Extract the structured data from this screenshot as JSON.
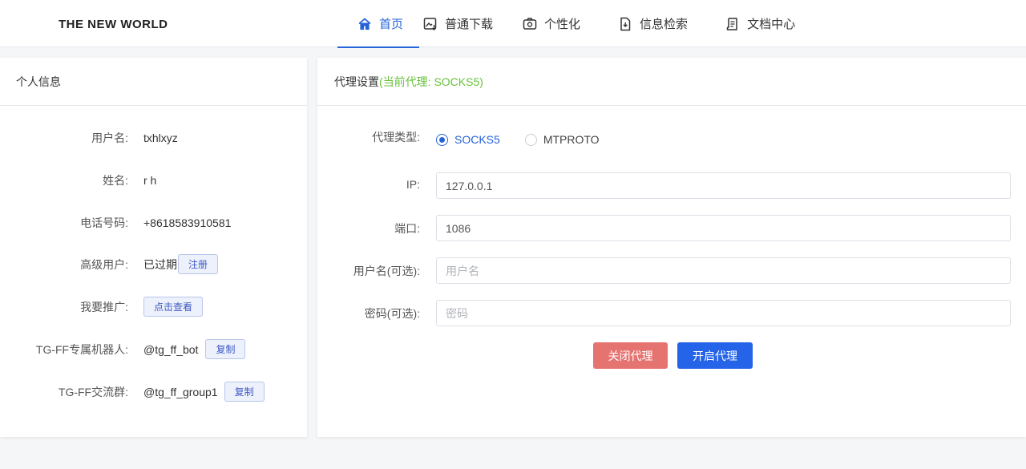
{
  "header": {
    "logo": "THE NEW WORLD",
    "nav": [
      {
        "label": "首页",
        "icon": "home-icon"
      },
      {
        "label": "普通下载",
        "icon": "image-download-icon"
      },
      {
        "label": "个性化",
        "icon": "customize-icon"
      },
      {
        "label": "信息检索",
        "icon": "document-search-icon"
      },
      {
        "label": "文档中心",
        "icon": "docs-icon"
      }
    ],
    "active_index": 0
  },
  "profile": {
    "title": "个人信息",
    "username_label": "用户名:",
    "username": "txhlxyz",
    "name_label": "姓名:",
    "name": "r h",
    "phone_label": "电话号码:",
    "phone": "+8618583910581",
    "vip_label": "高级用户:",
    "vip_status": "已过期",
    "register_button": "注册",
    "promo_label": "我要推广:",
    "promo_button": "点击查看",
    "bot_label": "TG-FF专属机器人:",
    "bot": "@tg_ff_bot",
    "bot_copy": "复制",
    "group_label": "TG-FF交流群:",
    "group": "@tg_ff_group1",
    "group_copy": "复制"
  },
  "proxy": {
    "title": "代理设置",
    "current": "(当前代理: SOCKS5)",
    "type_label": "代理类型:",
    "type_options": [
      "SOCKS5",
      "MTPROTO"
    ],
    "type_selected": "SOCKS5",
    "ip_label": "IP:",
    "ip": "127.0.0.1",
    "port_label": "端口:",
    "port": "1086",
    "user_label": "用户名(可选):",
    "user_placeholder": "用户名",
    "pass_label": "密码(可选):",
    "pass_placeholder": "密码",
    "close_button": "关闭代理",
    "open_button": "开启代理"
  },
  "colors": {
    "accent": "#2563d8",
    "current_proxy": "#67c23a",
    "close_button": "#e57370",
    "open_button": "#2563e8"
  }
}
